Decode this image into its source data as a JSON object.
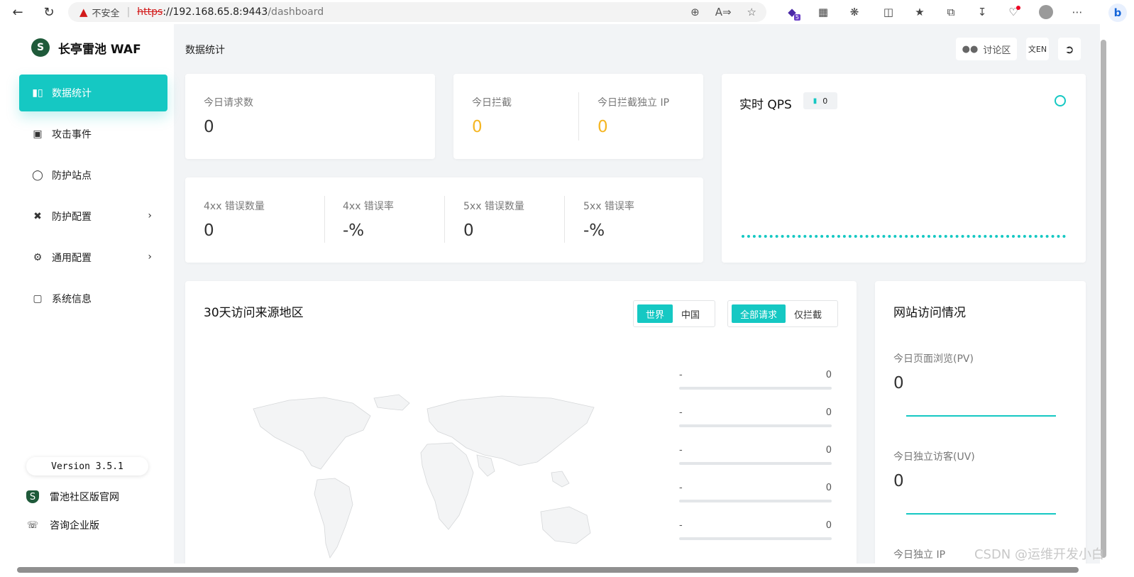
{
  "browser": {
    "security_label": "不安全",
    "url_scheme": "https",
    "url_host": "://192.168.65.8:9443",
    "url_path": "/dashboard",
    "extension_badge": "5"
  },
  "sidebar": {
    "logo_text": "长亭雷池 WAF",
    "items": [
      {
        "label": "数据统计",
        "icon": "bar-chart-icon"
      },
      {
        "label": "攻击事件",
        "icon": "document-icon"
      },
      {
        "label": "防护站点",
        "icon": "shield-icon"
      },
      {
        "label": "防护配置",
        "icon": "tools-icon"
      },
      {
        "label": "通用配置",
        "icon": "gear-icon"
      },
      {
        "label": "系统信息",
        "icon": "monitor-icon"
      }
    ],
    "version": "Version 3.5.1",
    "community_link": "雷池社区版官网",
    "enterprise_link": "咨询企业版"
  },
  "header": {
    "page_title": "数据统计",
    "forum_button": "讨论区"
  },
  "stats": {
    "requests_label": "今日请求数",
    "requests_value": "0",
    "blocked_label": "今日拦截",
    "blocked_value": "0",
    "blocked_ip_label": "今日拦截独立 IP",
    "blocked_ip_value": "0",
    "err4xx_count_label": "4xx 错误数量",
    "err4xx_count_value": "0",
    "err4xx_rate_label": "4xx 错误率",
    "err4xx_rate_value": "-%",
    "err5xx_count_label": "5xx 错误数量",
    "err5xx_count_value": "0",
    "err5xx_rate_label": "5xx 错误率",
    "err5xx_rate_value": "-%"
  },
  "qps": {
    "title": "实时 QPS",
    "value": "0"
  },
  "geo": {
    "title": "30天访问来源地区",
    "scope_options": [
      "世界",
      "中国"
    ],
    "scope_selected": "世界",
    "filter_options": [
      "全部请求",
      "仅拦截"
    ],
    "filter_selected": "全部请求",
    "ranking": [
      {
        "name": "-",
        "value": "0"
      },
      {
        "name": "-",
        "value": "0"
      },
      {
        "name": "-",
        "value": "0"
      },
      {
        "name": "-",
        "value": "0"
      },
      {
        "name": "-",
        "value": "0"
      }
    ]
  },
  "site": {
    "title": "网站访问情况",
    "pv_label": "今日页面浏览(PV)",
    "pv_value": "0",
    "uv_label": "今日独立访客(UV)",
    "uv_value": "0",
    "ip_label": "今日独立 IP"
  },
  "watermark": "CSDN @运维开发小白",
  "colors": {
    "accent": "#15c8c3",
    "warning": "#f5b623",
    "logo_green": "#1f5a3a"
  }
}
